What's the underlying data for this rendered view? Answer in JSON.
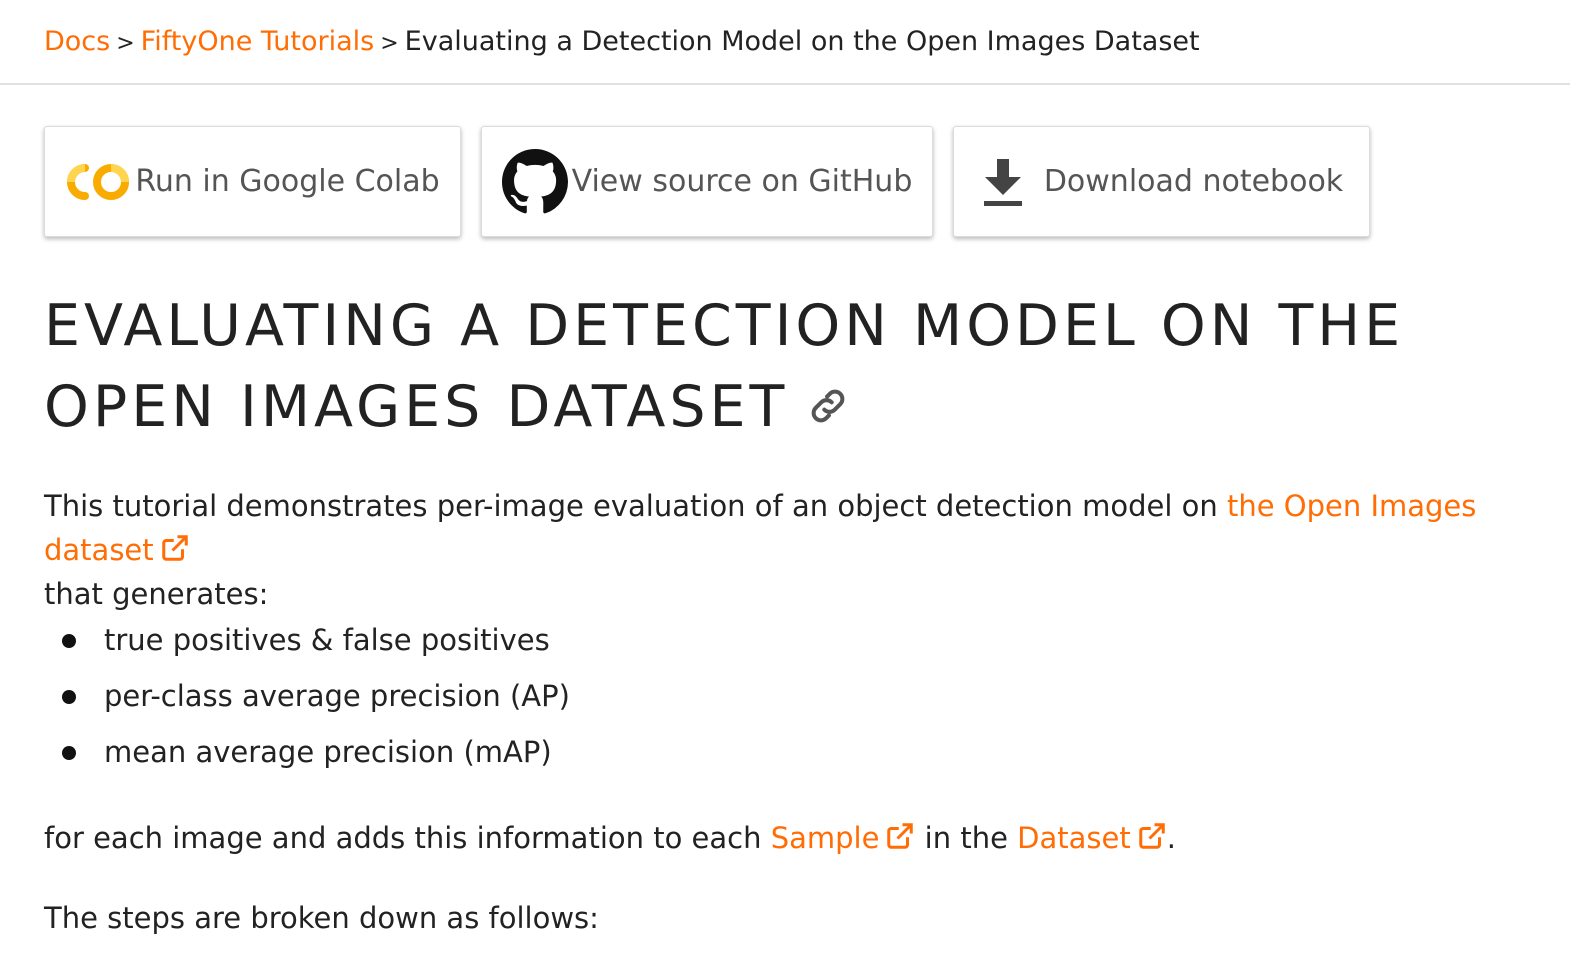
{
  "breadcrumb": {
    "items": [
      {
        "label": "Docs"
      },
      {
        "label": "FiftyOne Tutorials"
      }
    ],
    "separator": ">",
    "current": "Evaluating a Detection Model on the Open Images Dataset"
  },
  "buttons": {
    "colab": {
      "label": "Run in Google Colab",
      "icon": "colab-icon"
    },
    "github": {
      "label": "View source on GitHub",
      "icon": "github-icon"
    },
    "download": {
      "label": "Download notebook",
      "icon": "download-icon"
    }
  },
  "title": "EVALUATING A DETECTION MODEL ON THE OPEN IMAGES DATASET",
  "intro": {
    "text": "This tutorial demonstrates per-image evaluation of an object detection model on ",
    "link": "the Open Images dataset",
    "after": " that generates:"
  },
  "bullets": [
    "true positives & false positives",
    "per-class average precision (AP)",
    "mean average precision (mAP)"
  ],
  "para2": {
    "before": "for each image and adds this information to each ",
    "link1": "Sample",
    "middle": " in the ",
    "link2": "Dataset",
    "after": "."
  },
  "para3": "The steps are broken down as follows:",
  "colors": {
    "accent": "#ff6d04",
    "text": "#222222",
    "button_text": "#555555"
  }
}
